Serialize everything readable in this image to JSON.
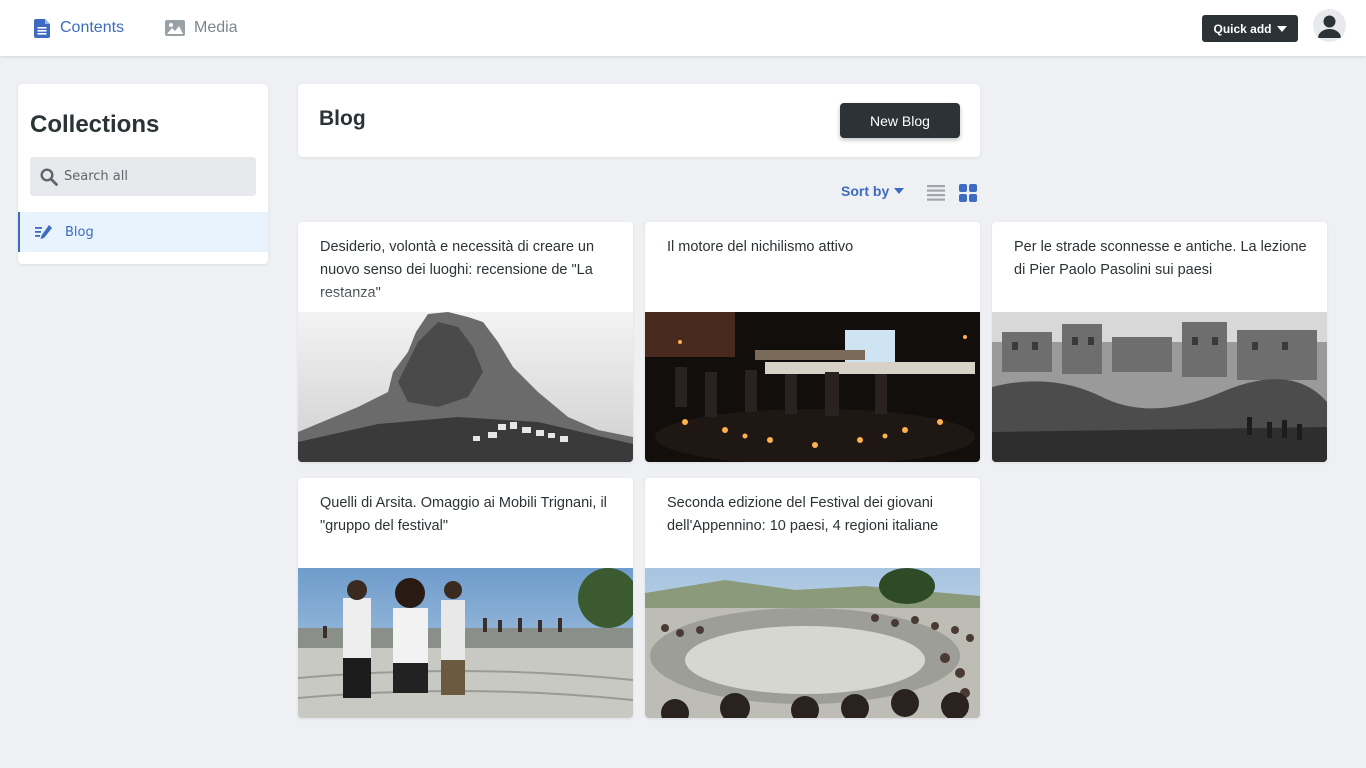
{
  "nav": {
    "contents_label": "Contents",
    "media_label": "Media",
    "quick_add_label": "Quick add"
  },
  "sidebar": {
    "title": "Collections",
    "search_placeholder": "Search all",
    "items": [
      {
        "label": "Blog",
        "icon": "edit-lines-icon"
      }
    ]
  },
  "header": {
    "title": "Blog",
    "new_button_label": "New Blog"
  },
  "toolbar": {
    "sort_label": "Sort by",
    "views": [
      "list-view-icon",
      "grid-view-icon"
    ],
    "active_view": "grid"
  },
  "cards": [
    {
      "title": "Desiderio, volontà e necessità di creare un nuovo senso dei luoghi: recensione de \"La restanza\"",
      "image": "black-and-white mountain village photo"
    },
    {
      "title": "Il motore del nichilismo attivo",
      "image": "night gathering with candles and screen"
    },
    {
      "title": "Per le strade sconnesse e antiche. La lezione di Pier Paolo Pasolini sui paesi",
      "image": "black-and-white old town photo"
    },
    {
      "title": "Quelli di Arsita. Omaggio ai Mobili Trignani, il \"gruppo del festival\"",
      "image": "musicians playing in a square"
    },
    {
      "title": "Seconda edizione del Festival dei giovani dell'Appennino: 10 paesi, 4 regioni italiane",
      "image": "crowd in an open-air amphitheatre"
    }
  ],
  "colors": {
    "accent": "#3d6bc1",
    "dark": "#2b3336",
    "background": "#eef0f4",
    "active_item_bg": "#e9f3fd"
  }
}
